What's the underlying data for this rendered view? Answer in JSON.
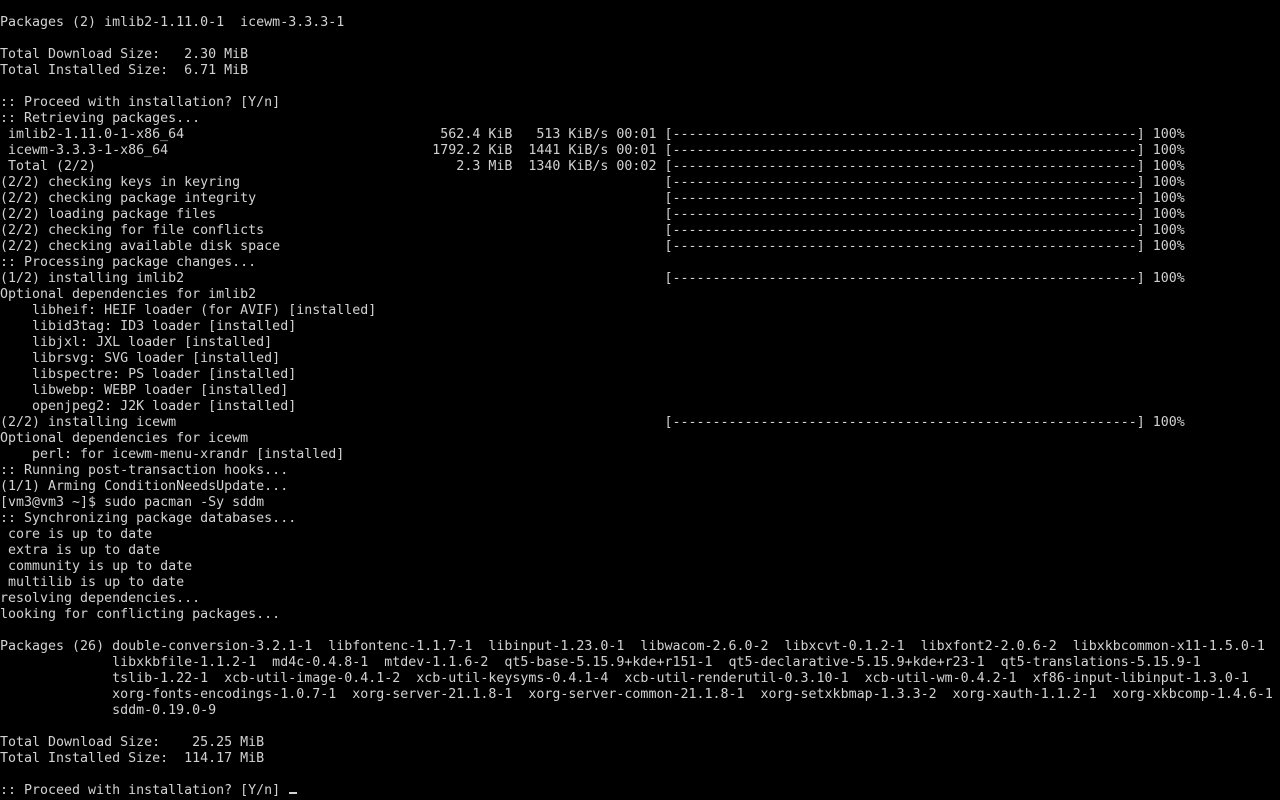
{
  "terminal": {
    "lines": [
      "Packages (2) imlib2-1.11.0-1  icewm-3.3.3-1",
      "",
      "Total Download Size:   2.30 MiB",
      "Total Installed Size:  6.71 MiB",
      "",
      ":: Proceed with installation? [Y/n]",
      ":: Retrieving packages...",
      " imlib2-1.11.0-1-x86_64                                562.4 KiB   513 KiB/s 00:01 [----------------------------------------------------------] 100%",
      " icewm-3.3.3-1-x86_64                                 1792.2 KiB  1441 KiB/s 00:01 [----------------------------------------------------------] 100%",
      " Total (2/2)                                             2.3 MiB  1340 KiB/s 00:02 [----------------------------------------------------------] 100%",
      "(2/2) checking keys in keyring                                                     [----------------------------------------------------------] 100%",
      "(2/2) checking package integrity                                                   [----------------------------------------------------------] 100%",
      "(2/2) loading package files                                                        [----------------------------------------------------------] 100%",
      "(2/2) checking for file conflicts                                                  [----------------------------------------------------------] 100%",
      "(2/2) checking available disk space                                                [----------------------------------------------------------] 100%",
      ":: Processing package changes...",
      "(1/2) installing imlib2                                                            [----------------------------------------------------------] 100%",
      "Optional dependencies for imlib2",
      "    libheif: HEIF loader (for AVIF) [installed]",
      "    libid3tag: ID3 loader [installed]",
      "    libjxl: JXL loader [installed]",
      "    librsvg: SVG loader [installed]",
      "    libspectre: PS loader [installed]",
      "    libwebp: WEBP loader [installed]",
      "    openjpeg2: J2K loader [installed]",
      "(2/2) installing icewm                                                             [----------------------------------------------------------] 100%",
      "Optional dependencies for icewm",
      "    perl: for icewm-menu-xrandr [installed]",
      ":: Running post-transaction hooks...",
      "(1/1) Arming ConditionNeedsUpdate...",
      "[vm3@vm3 ~]$ sudo pacman -Sy sddm",
      ":: Synchronizing package databases...",
      " core is up to date",
      " extra is up to date",
      " community is up to date",
      " multilib is up to date",
      "resolving dependencies...",
      "looking for conflicting packages...",
      "",
      "Packages (26) double-conversion-3.2.1-1  libfontenc-1.1.7-1  libinput-1.23.0-1  libwacom-2.6.0-2  libxcvt-0.1.2-1  libxfont2-2.0.6-2  libxkbcommon-x11-1.5.0-1",
      "              libxkbfile-1.1.2-1  md4c-0.4.8-1  mtdev-1.1.6-2  qt5-base-5.15.9+kde+r151-1  qt5-declarative-5.15.9+kde+r23-1  qt5-translations-5.15.9-1",
      "              tslib-1.22-1  xcb-util-image-0.4.1-2  xcb-util-keysyms-0.4.1-4  xcb-util-renderutil-0.3.10-1  xcb-util-wm-0.4.2-1  xf86-input-libinput-1.3.0-1",
      "              xorg-fonts-encodings-1.0.7-1  xorg-server-21.1.8-1  xorg-server-common-21.1.8-1  xorg-setxkbmap-1.3.3-2  xorg-xauth-1.1.2-1  xorg-xkbcomp-1.4.6-1",
      "              sddm-0.19.0-9",
      "",
      "Total Download Size:    25.25 MiB",
      "Total Installed Size:  114.17 MiB",
      ""
    ],
    "prompt": ":: Proceed with installation? [Y/n] "
  }
}
